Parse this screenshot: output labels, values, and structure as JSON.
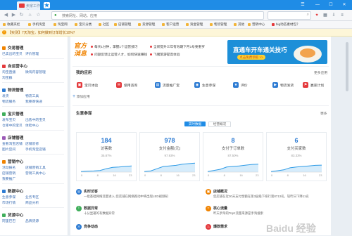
{
  "browser": {
    "tab_title": "卖家工作台",
    "address": "搜索网址、网站、应用",
    "bookmarks": [
      "收藏夹栏",
      "手机淘宝",
      "淘宝网",
      "宝贝分类",
      "社区",
      "店铺管理",
      "货源管理",
      "客户运营",
      "资金管理",
      "物流管理",
      "其他",
      "营销中心",
      "big动态素材包？"
    ]
  },
  "notice": {
    "text": "【实测】7天淘宝，如何做到订单增长10%？"
  },
  "sidebar": {
    "sections": [
      {
        "title": "交易管理",
        "color": "#f08300",
        "items": [
          "已卖出的宝贝",
          "评价管理"
        ]
      },
      {
        "title": "自运营中心",
        "color": "#e4393c",
        "items": [
          "淘宝直播",
          "微淘内容管理",
          "淘宝群"
        ]
      },
      {
        "title": "物流管理",
        "color": "#2e7cd3",
        "items": [
          "发货",
          "物流工具",
          "物流服务",
          "我要寄快递"
        ]
      },
      {
        "title": "宝贝管理",
        "color": "#3fae5a",
        "items": [
          "发布宝贝",
          "出售中的宝贝",
          "仓库中的宝贝",
          "体检中心"
        ]
      },
      {
        "title": "店铺管理",
        "color": "#9b59b6",
        "items": [
          "查看淘宝店铺",
          "店铺装修",
          "图片空间",
          "手机淘宝店铺"
        ]
      },
      {
        "title": "营销中心",
        "color": "#f08300",
        "items": [
          "活动报名",
          "店铺营销工具",
          "店铺营销",
          "营销工具中心",
          "我要推广"
        ]
      },
      {
        "title": "数据中心",
        "color": "#2e7cd3",
        "items": [
          "生意参谋",
          "业务专区",
          "市场行情",
          "商品分析"
        ]
      },
      {
        "title": "货源中心",
        "color": "#3fae5a",
        "items": [
          "阿里巴巴",
          "品牌货源"
        ]
      }
    ]
  },
  "promo": {
    "brand_line1": "官方",
    "brand_line2": "消息",
    "news": [
      "每天1分钟，掌握1个运营技巧",
      "全新提升三年有效期下月1号要重罗",
      "问题反馈让运营人才，如何快速赚钱",
      "飞猪旅游提高体验"
    ],
    "banner_title": "直通车开车通关技巧",
    "banner_button": "点击免费领取 >>"
  },
  "apps": {
    "title": "我的应用",
    "more": "更多应用",
    "items": [
      {
        "label": "宝贝体验",
        "icon": "gift-icon",
        "color": "#e4393c"
      },
      {
        "label": "使用咨询",
        "icon": "chat-icon",
        "color": "#e4393c"
      },
      {
        "label": "流量推广宝",
        "icon": "chart-icon",
        "color": "#2e7cd3"
      },
      {
        "label": "生意参谋",
        "icon": "eye-icon",
        "color": "#2e7cd3"
      },
      {
        "label": "评价",
        "icon": "star-icon",
        "color": "#2e7cd3"
      },
      {
        "label": "物流发货",
        "icon": "truck-icon",
        "color": "#2e7cd3"
      },
      {
        "label": "赢家计划",
        "icon": "flag-icon",
        "color": "#e4393c"
      }
    ],
    "add": "添加应用"
  },
  "stats": {
    "title": "生意参谋",
    "more": "更多",
    "tabs": [
      "实时数据",
      "经营概况"
    ],
    "cards": [
      {
        "value": "184",
        "label": "访客数",
        "pct": "35.87%",
        "points": [
          0.05,
          0.08,
          0.1,
          0.14,
          0.3,
          0.42,
          0.45,
          0.5,
          0.55
        ]
      },
      {
        "value": "978",
        "label": "支付金额(元)",
        "pct": "97.93%",
        "points": [
          0.05,
          0.1,
          0.3,
          0.5,
          0.55,
          0.6,
          0.7,
          0.75,
          0.8
        ]
      },
      {
        "value": "8",
        "label": "支付子订单数",
        "pct": "87.50%",
        "points": [
          0.05,
          0.15,
          0.25,
          0.45,
          0.5,
          0.55,
          0.62,
          0.68,
          0.7
        ]
      },
      {
        "value": "6",
        "label": "支付买家数",
        "pct": "83.33%",
        "points": [
          0.05,
          0.12,
          0.2,
          0.38,
          0.45,
          0.5,
          0.55,
          0.6,
          0.62
        ]
      }
    ],
    "axis_ticks": [
      "0",
      "8",
      "16",
      "23"
    ]
  },
  "news": [
    {
      "title": "实时访客",
      "desc": "一批基础网络流量进入·您店铺在网络跑动中将出现LED视频知",
      "color": "#2e7cd3",
      "icon": "user-icon"
    },
    {
      "title": "店铺概况",
      "desc": "您店铺在近30天支付金额在第3层级下排行第8713名，较昨日下降11名",
      "color": "#f08300",
      "icon": "shop-icon"
    },
    {
      "title": "数据异常",
      "desc": "十分显著的有数据异常",
      "color": "#3fae5a",
      "icon": "alert-icon"
    },
    {
      "title": "核心流量",
      "desc": "昨天手淘的Top1流量来源是手淘搜索",
      "color": "#f08300",
      "icon": "flow-icon"
    },
    {
      "title": "竞争动态",
      "desc": "",
      "color": "#2e7cd3",
      "icon": "compete-icon"
    },
    {
      "title": "爆款需求",
      "desc": "",
      "color": "#e4393c",
      "icon": "fire-icon"
    }
  ],
  "watermark": "Baidu 经验"
}
